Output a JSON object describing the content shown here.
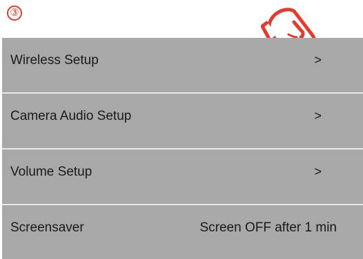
{
  "step_marker": "③",
  "menu": {
    "items": [
      {
        "label": "Wireless Setup",
        "indicator": ">"
      },
      {
        "label": "Camera Audio Setup",
        "indicator": ">"
      },
      {
        "label": "Volume Setup",
        "indicator": ">"
      },
      {
        "label": "Screensaver",
        "value": "Screen OFF after 1 min"
      }
    ]
  },
  "colors": {
    "row_background": "#a8a8a8",
    "row_divider": "#e8e8e8",
    "accent": "#e53a2b"
  },
  "icons": {
    "pointer": "pointing-hand-icon"
  }
}
